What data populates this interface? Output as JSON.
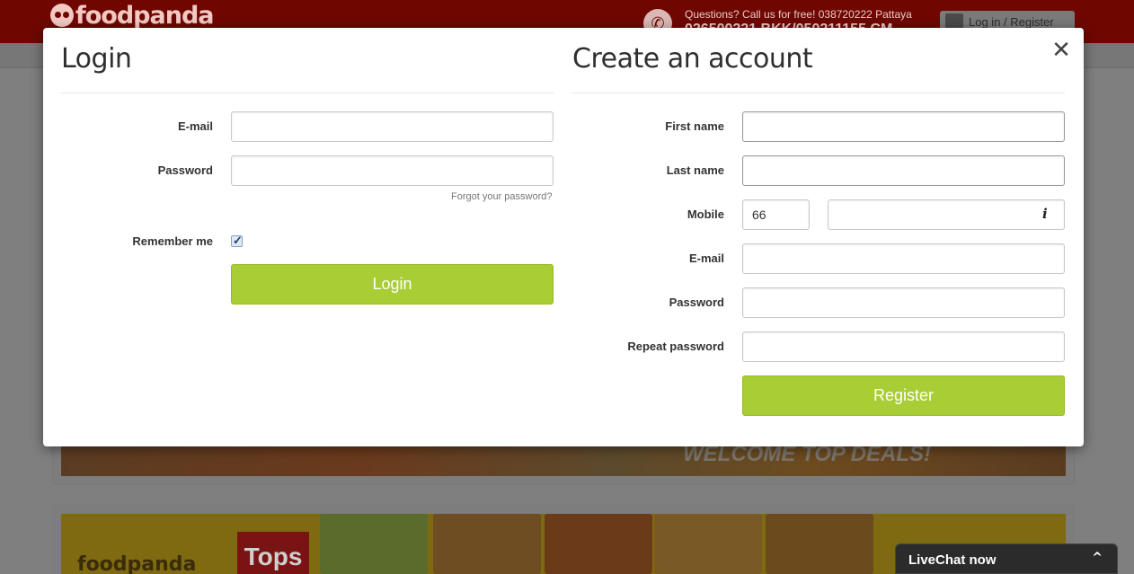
{
  "header": {
    "brand": "foodpanda",
    "contact_line1": "Questions? Call us for free! 038720222 Pattaya",
    "contact_line2": "026500221 BKK/050211155 CM",
    "login_register_label": "Log in / Register"
  },
  "banners": {
    "promo_text": "WELCOME TOP DEALS!",
    "brand2": "foodpanda",
    "partner": "Tops"
  },
  "modal": {
    "close_glyph": "✕",
    "login": {
      "title": "Login",
      "email_label": "E-mail",
      "email_value": "",
      "password_label": "Password",
      "password_value": "",
      "forgot_link": "Forgot your password?",
      "remember_label": "Remember me",
      "remember_checked": true,
      "submit_label": "Login"
    },
    "register": {
      "title": "Create an account",
      "first_name_label": "First name",
      "first_name_value": "",
      "last_name_label": "Last name",
      "last_name_value": "",
      "mobile_label": "Mobile",
      "mobile_prefix": "66",
      "mobile_value": "",
      "info_glyph": "i",
      "email_label": "E-mail",
      "email_value": "",
      "password_label": "Password",
      "password_value": "",
      "repeat_password_label": "Repeat password",
      "repeat_password_value": "",
      "submit_label": "Register"
    }
  },
  "livechat": {
    "label": "LiveChat now",
    "arrow": "^"
  },
  "colors": {
    "accent_green": "#a9cd34",
    "brand_red": "#d40b00",
    "overlay": "#7f7f7f"
  }
}
